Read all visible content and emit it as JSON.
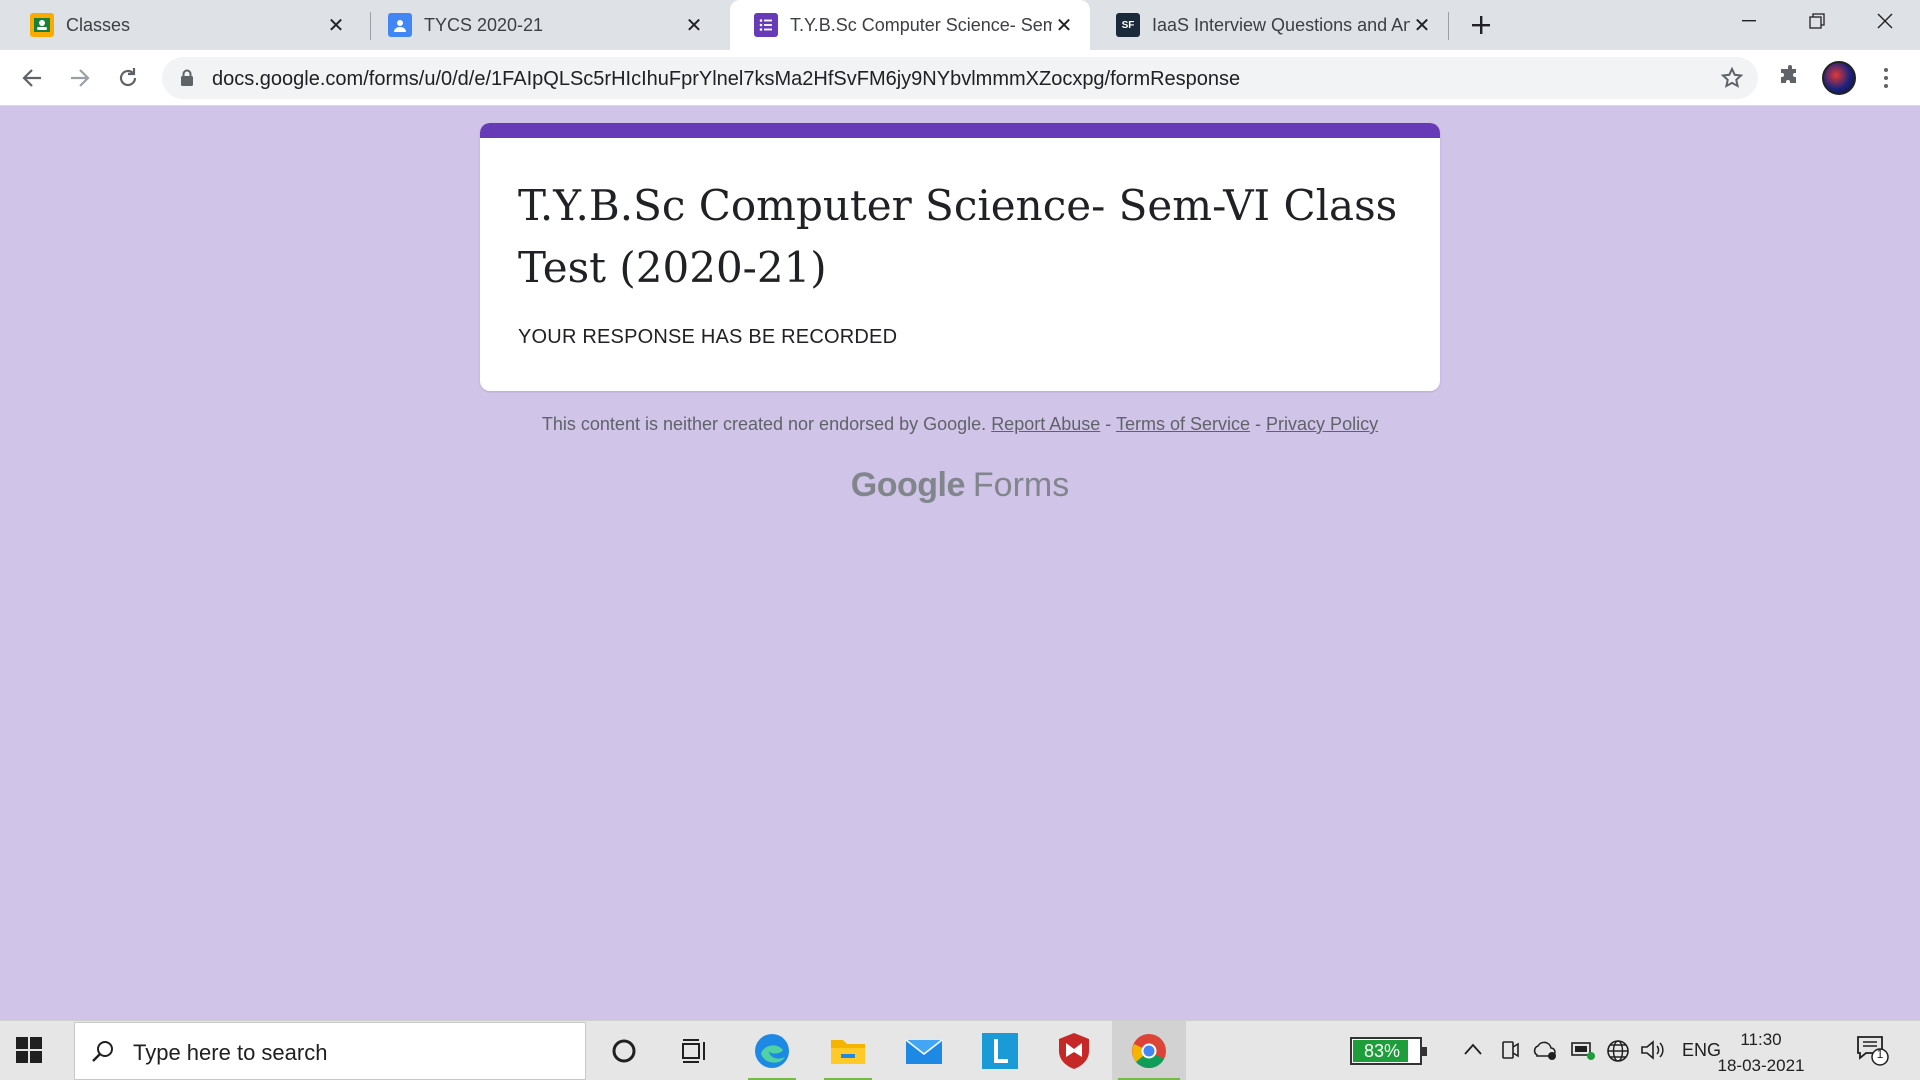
{
  "browser": {
    "tabs": [
      {
        "title": "Classes",
        "favicon": "google-classroom-icon",
        "active": false
      },
      {
        "title": "TYCS 2020-21",
        "favicon": "contact-card-icon",
        "active": false
      },
      {
        "title": "T.Y.B.Sc Computer Science- Sem-",
        "favicon": "google-forms-icon",
        "active": true
      },
      {
        "title": "IaaS Interview Questions and Ans",
        "favicon": "sf-site-icon",
        "active": false
      }
    ],
    "sf_favicon_text": "SF",
    "url": "docs.google.com/forms/u/0/d/e/1FAIpQLSc5rHIcIhuFprYlnel7ksMa2HfSvFM6jy9NYbvlmmmXZocxpg/formResponse"
  },
  "form": {
    "title": "T.Y.B.Sc Computer Science- Sem-VI Class Test (2020-21)",
    "message": "YOUR RESPONSE HAS BE RECORDED",
    "accent_color": "#673ab7",
    "page_background": "#d1c4e9"
  },
  "footer": {
    "disclaimer": "This content is neither created nor endorsed by Google.",
    "report_abuse": "Report Abuse",
    "separator": "-",
    "terms": "Terms of Service",
    "privacy": "Privacy Policy",
    "brand_google": "Google",
    "brand_forms": "Forms"
  },
  "taskbar": {
    "search_placeholder": "Type here to search",
    "battery_percent": "83%",
    "battery_level": 0.83,
    "language": "ENG",
    "time": "11:30",
    "date": "18-03-2021",
    "notification_count": "1"
  }
}
